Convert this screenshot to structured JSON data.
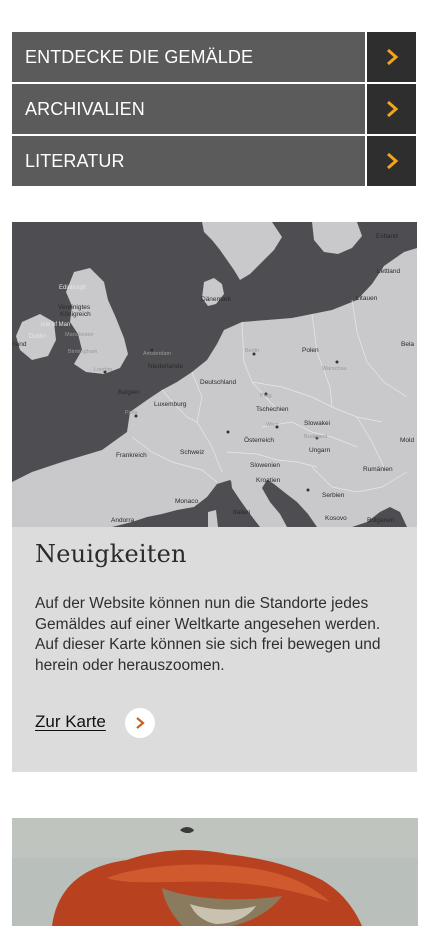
{
  "nav": {
    "items": [
      {
        "label": "ENTDECKE DIE GEMÄLDE",
        "icon": "chevron-right-icon"
      },
      {
        "label": "ARCHIVALIEN",
        "icon": "chevron-right-icon"
      },
      {
        "label": "LITERATUR",
        "icon": "chevron-right-icon"
      }
    ]
  },
  "map": {
    "labels": {
      "estland": "Estland",
      "lettland": "Lettland",
      "litauen": "Litauen",
      "edinburgh": "Edinburgh",
      "vereinigtes": "Vereinigtes",
      "koenigreich": "Königreich",
      "isle_of_man": "Isle of Man",
      "dublin": "Dublin",
      "land": "rland",
      "manchester": "Manchester",
      "birmingham": "Birmingham",
      "london": "London",
      "daenemark": "Dänemark",
      "amsterdam": "Amsterdam",
      "niederlande": "Niederlande",
      "polen": "Polen",
      "warschau": "Warschau",
      "bela": "Bela",
      "deutschland": "Deutschland",
      "belgien": "Belgien",
      "luxemburg": "Luxemburg",
      "tschechien": "Tschechien",
      "slowakei": "Slowakei",
      "paris": "Paris",
      "oesterreich": "Österreich",
      "ungarn": "Ungarn",
      "mold": "Mold",
      "frankreich": "Frankreich",
      "schweiz": "Schweiz",
      "slowenien": "Slowenien",
      "kroatien": "Kroatien",
      "rumaenien": "Rumänien",
      "serbien": "Serbien",
      "monaco": "Monaco",
      "italien": "Italien",
      "andorra": "Andorra",
      "kosovo": "Kosovo",
      "bulgarien": "Bulgarien",
      "berlin": "Berlin",
      "wien": "Wien",
      "budapest": "Budapest",
      "prag": "Prag"
    }
  },
  "news": {
    "title": "Neuigkeiten",
    "body": "Auf der Website können nun die Standorte jedes Gemäldes auf einer Weltkarte angesehen werden. Auf dieser Karte können sie sich frei bewegen und herein oder herauszoomen.",
    "link_label": "Zur Karte"
  },
  "colors": {
    "nav_bg": "#5b5b5b",
    "arrow_bg": "#2e2e2e",
    "accent": "#f2a51a",
    "card_bg": "#dcdcdc",
    "link_chevron": "#c8621f"
  }
}
